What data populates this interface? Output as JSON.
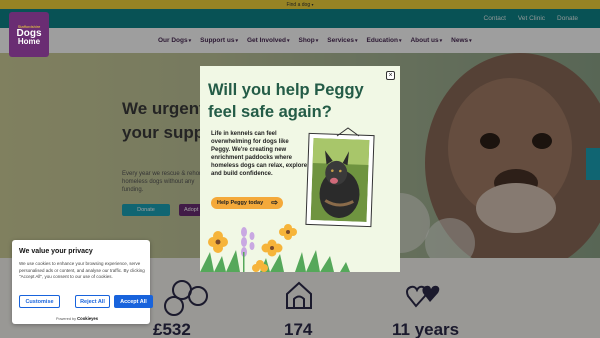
{
  "topbar": {
    "find_dog": "Find a dog"
  },
  "utility_links": [
    "Contact",
    "Vet Clinic",
    "Donate"
  ],
  "logo": {
    "line1": "Staffordshire",
    "line2": "Dogs",
    "line3": "Home",
    "line4": ""
  },
  "nav": [
    {
      "label": "Our Dogs"
    },
    {
      "label": "Support us"
    },
    {
      "label": "Get Involved"
    },
    {
      "label": "Shop"
    },
    {
      "label": "Services"
    },
    {
      "label": "Education"
    },
    {
      "label": "About us"
    },
    {
      "label": "News"
    }
  ],
  "hero": {
    "title": "We urgently need your support!",
    "text": "Every year we rescue & rehome homeless dogs without any funding.",
    "btn_donate": "Donate",
    "btn_adopt": "Adopt"
  },
  "stats": {
    "stat1": "£532",
    "stat2": "174",
    "stat3": "11 years"
  },
  "modal": {
    "title": "Will you help Peggy feel safe again?",
    "text": "Life in kennels can feel overwhelming for dogs like Peggy. We're creating new enrichment paddocks where homeless dogs can relax, explore and build confidence.",
    "cta": "Help Peggy today",
    "close": "×"
  },
  "cookie": {
    "title": "We value your privacy",
    "text": "We use cookies to enhance your browsing experience, serve personalised ads or content, and analyse our traffic. By clicking \"Accept All\", you consent to our use of cookies.",
    "customise": "Customise",
    "reject": "Reject All",
    "accept": "Accept All",
    "powered_by": "Powered by",
    "powered_brand": "Cookieyes"
  },
  "colors": {
    "accent_yellow": "#f2d43a",
    "teal": "#0d8589",
    "purple": "#6a2d73",
    "modal_bg": "#f1f8e5",
    "modal_title": "#245c47",
    "cta_orange": "#f4a93a",
    "cookie_blue": "#1863dc"
  },
  "icons": [
    "chevron-down-icon",
    "close-icon",
    "arrow-right-icon",
    "coins-icon",
    "kennel-icon",
    "hearts-icon"
  ]
}
